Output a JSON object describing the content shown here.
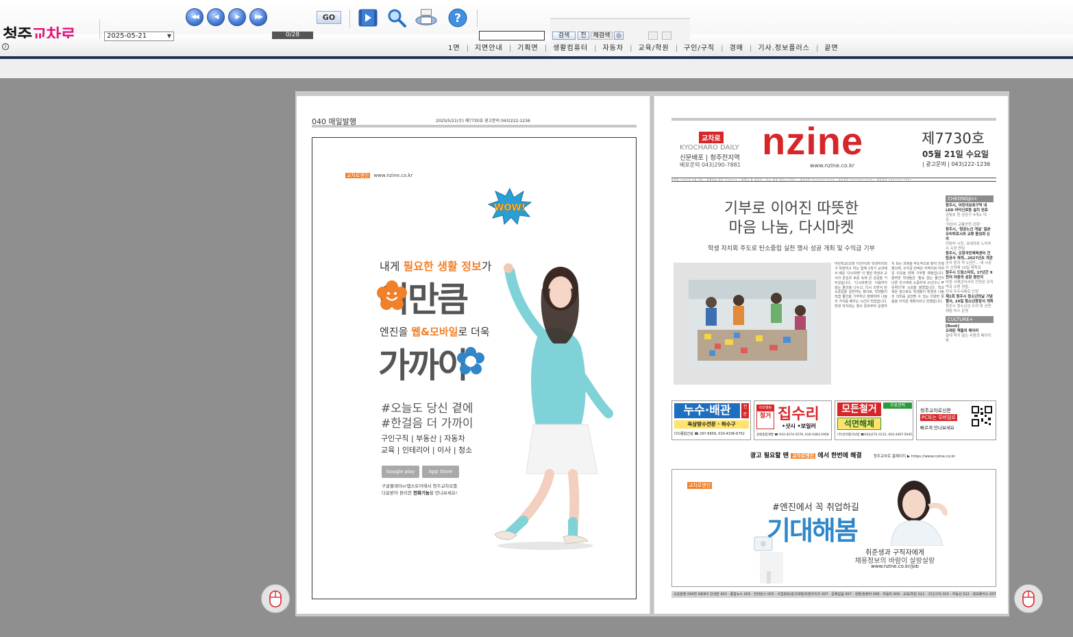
{
  "toolbar": {
    "logo_black": "청주",
    "logo_pink": "교차로",
    "date_value": "2025-05-21",
    "page_counter": "0/28",
    "nav_first": "◀◀",
    "nav_prev": "◀",
    "nav_next": "▶",
    "nav_last": "▶▶",
    "go_label": "GO",
    "search_label": "검색",
    "search_btn2": "전",
    "search_btn3": "체검색",
    "search_btn4": "◎",
    "info_icon": "i"
  },
  "sections": [
    "1면",
    "지면안내",
    "기획면",
    "생활컴퓨터",
    "자동차",
    "교육/학원",
    "구인/구직",
    "경매",
    "기사.정보플러스",
    "끝면"
  ],
  "left_page": {
    "page_label": "040 매일발행",
    "dateline": "2025/5/21(수) 제7730호  광고문의 043)222-1236",
    "ad": {
      "brand_badge": "교차로엔진",
      "url": "www.nzine.co.kr",
      "wow": "WOW!",
      "line1_pre": "내게 ",
      "line1_accent": "필요한 생활 정보",
      "line1_post": "가",
      "big1": "이만큼",
      "line2_pre": "엔진을 ",
      "line2_accent": "웹&모바일",
      "line2_post": "로 더욱",
      "big2": "가까이",
      "hashtag1": "#오늘도 당신 곁에",
      "hashtag2": "#한걸음 더 가까이",
      "categories1": "구인구직 | 부동산 | 자동차",
      "categories2": "교육 | 인테리어 | 이사 | 청소",
      "store1": "Google play",
      "store2": "App Store",
      "note1": "구글플레이or앱스토어에서 청주교차로를",
      "note2_pre": "다운받아 편리한 ",
      "note2_strong": "전화기능",
      "note2_post": "을 만나보세요!"
    }
  },
  "right_page": {
    "badge": "교차로",
    "brand_small": "KYOCHARO DAILY",
    "distribution": "신문배포 | 청주전지역",
    "delivery_phone": "배포문의 043)290-7881",
    "nzine_logo": "nzine",
    "nzine_url": "www.nzine.co.kr",
    "issue_no": "제7730호",
    "issue_date": "05월 21일 수요일",
    "ad_phone": "| 광고문의 | 043)222-1236",
    "rule_text": "발행일 1993년 6월 8일 · 등록번호 청주 가00021 · 발행인 겸 편집인 · 주소 충북 청주시 흥덕구 · 대표전화 043)222-1236 · 광고문의 043)222-1236 · 배포문의 043)290-7881",
    "headline1": "기부로 이어진 따뜻한",
    "headline2": "마음 나눔, 다시마켓",
    "subhead": "학생 자치회 주도로 탄소중립 실천 행사 성공 개최 및 수익금 기부",
    "body": "어린학교(교장 이선아)와 학생자치회가 마련하고 하는 함께 1학기 교과에서 배운 '다시마켓' 이 열린 학생과 교사의 관심과 호응 속에 큰 성공을 거두었습니다. '다시마켓'은 이용하지 않는 물건을 나누고, 다시 쓰면서 탄소중립을 실천하는 행사로, 학생들이 직접 물건을 기부하고 판매하며 나눔의 가치를 배우는 시간이 되었습니다. 학생 자치회는 행사 준비부터 운영까지 모든 과정을 주도적으로 맡아 진행했으며, 수익금 전액은 지역사회 어려운 이웃을 위해 기부할 예정입니다. 참여한 학생들은 '필요 없는 물건이 다른 친구에게 소중하게 쓰인다니 뿌듯하다'며 소감을 밝혔습니다. 학교 측은 앞으로도 학생들이 환경과 나눔의 의미를 실천할 수 있는 다양한 활동을 이어갈 계획이라고 전했습니다.",
    "sidebar": {
      "tag1": "CHEONGJU+",
      "items1": [
        [
          "청주시, 어린이보호구역 내 LED 바닥신호등 설치 완료",
          "strong"
        ],
        [
          "금빛초 등 상당구 4개소 대상…",
          "light"
        ],
        [
          "'어린이 교통안전 강화'",
          "light"
        ],
        [
          "청주시, '항공노선 개설' 일본 오비히로시와 교류 활성화 논의",
          "strong"
        ],
        [
          "이범석 시장, 요네자와 노리히사 시장 면담",
          "light"
        ],
        [
          "청주시, 오창국민체육센터 건립공사 재개…2027년초 개관",
          "strong"
        ],
        [
          "공사 중지 약 1년만… 새 시공사 선정해 20일 재착공",
          "light"
        ],
        [
          "청주시 드림스타트, 17년간 9천여 아동의 성장 동반자",
          "strong"
        ],
        [
          "아동 사례관리사의 안정된 조직력과 오랜 경험…",
          "light"
        ],
        [
          "전국 우수사례로 인정",
          "light"
        ],
        [
          "제1회 청주시 청소년의날 기념행사, 24일 청소년광장서 개최",
          "strong"
        ],
        [
          "청주시 청소년상·수여 및 공연·체험 부스 운영",
          "light"
        ]
      ],
      "tag2": "CULTURE+",
      "items2": [
        [
          "[Book]",
          "strong"
        ],
        [
          "오래된 책들의 메아리",
          "strong"
        ],
        [
          "절대 먹지 않는 사람의 베이지빛",
          "light"
        ]
      ]
    },
    "ads": {
      "ad1_title": "누수·배관",
      "ad1_side": "전문",
      "ad1_line": "옥상방수전문 · 하수구",
      "ad1_contact": "다다종합건설 ☎ 297-6959, 010-4336-6752",
      "ad2_tag": "리모델링",
      "ad2_sub": "철거",
      "ad2_title": "집수리",
      "ad2_line": "•샷시 •보일러",
      "ad2_contact": "성원종합개발 ☎ 010-4274-3579, 010-5483-1958",
      "ad3_title": "모든철거",
      "ad3_sub": "석면해체",
      "ad3_side": "무료견적",
      "ad3_contact": "(주)유리철거산업 ☎043)272-3115, 010-3407-5945",
      "ad4_line1": "청주교차로신문",
      "ad4_line2": "PC또는 모바일로",
      "ad4_line3": "빠르게 만나보세요"
    },
    "promo_pre": "광고 필요할 땐 ",
    "promo_badge": "교차로엔진",
    "promo_post": " 에서 한번에 해결",
    "promo_small": "청주교차로 홈페이지 ▶ https://www.nzine.co.kr",
    "job_ad": {
      "badge": "교차로엔진",
      "line1": "#엔진에서 꼭 취업하길",
      "big": "기대해봄",
      "line2": "취준생과 구직자에게",
      "line3": "채용정보의 바람이 살랑살랑",
      "url": "www.nzine.co.kr/job"
    },
    "footer": "오늘발행 040면   INDEX 안내면 003 · 종합뉴스 003 · 컨퍼런스 003 · 사업정보/광고대행/프랜차이즈 007 · 문제답읍 007 · 생활/컴퓨터 008 · 자동차 009 · 교육/학원 012 · 구인/구직 015 · 부동산 022 · 정보플러스 037 · 매일보기 038"
  },
  "colors": {
    "accent_blue": "#2f86c9",
    "brand_red": "#d7262a",
    "ad_orange": "#f0812a",
    "navy_line": "#1d3557"
  }
}
